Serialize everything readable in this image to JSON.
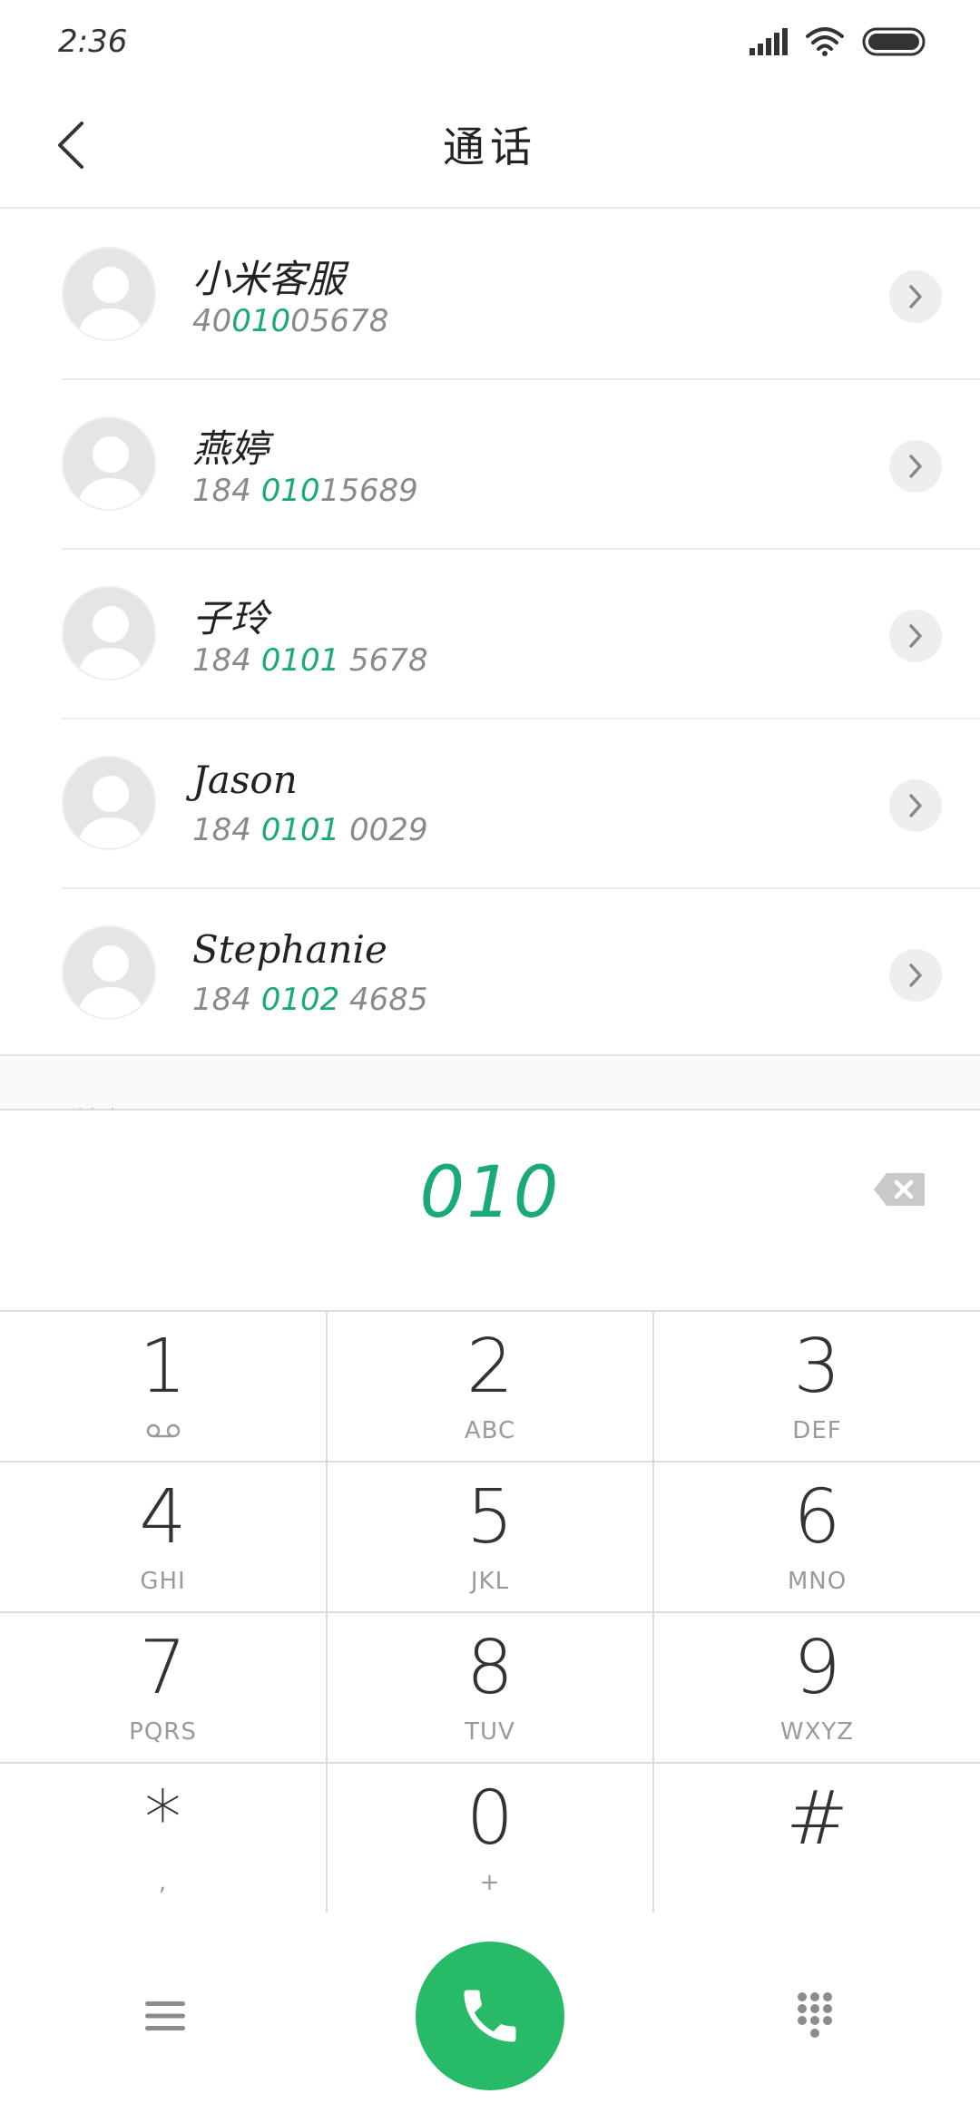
{
  "status_bar": {
    "time": "2:36"
  },
  "header": {
    "title": "通话"
  },
  "contacts": [
    {
      "name": "小米客服",
      "num_pre": "40",
      "num_match": "010",
      "num_post": "05678"
    },
    {
      "name": "燕婷",
      "num_pre": "184 ",
      "num_match": "010",
      "num_post": "15689"
    },
    {
      "name": "子玲",
      "num_pre": "184 ",
      "num_match": "0101",
      "num_post": " 5678"
    },
    {
      "name": "Jason",
      "num_pre": "184 ",
      "num_match": "0101",
      "num_post": " 0029"
    },
    {
      "name": "Stephanie",
      "num_pre": "184 ",
      "num_match": "0102",
      "num_post": " 4685"
    }
  ],
  "list_footer": "其它",
  "dialer": {
    "digits": "010"
  },
  "keypad": [
    {
      "digit": "1",
      "letters": ""
    },
    {
      "digit": "2",
      "letters": "ABC"
    },
    {
      "digit": "3",
      "letters": "DEF"
    },
    {
      "digit": "4",
      "letters": "GHI"
    },
    {
      "digit": "5",
      "letters": "JKL"
    },
    {
      "digit": "6",
      "letters": "MNO"
    },
    {
      "digit": "7",
      "letters": "PQRS"
    },
    {
      "digit": "8",
      "letters": "TUV"
    },
    {
      "digit": "9",
      "letters": "WXYZ"
    },
    {
      "digit": "*",
      "letters": ","
    },
    {
      "digit": "0",
      "letters": "+"
    },
    {
      "digit": "#",
      "letters": ""
    }
  ],
  "icons": {
    "back": "back-arrow-icon",
    "detail": "chevron-right-icon",
    "backspace": "backspace-icon",
    "voicemail": "voicemail-icon",
    "menu": "menu-icon",
    "call": "phone-icon",
    "dialpad": "dialpad-icon"
  },
  "colors": {
    "match": "#1aa97a",
    "call_button": "#27bb69"
  }
}
